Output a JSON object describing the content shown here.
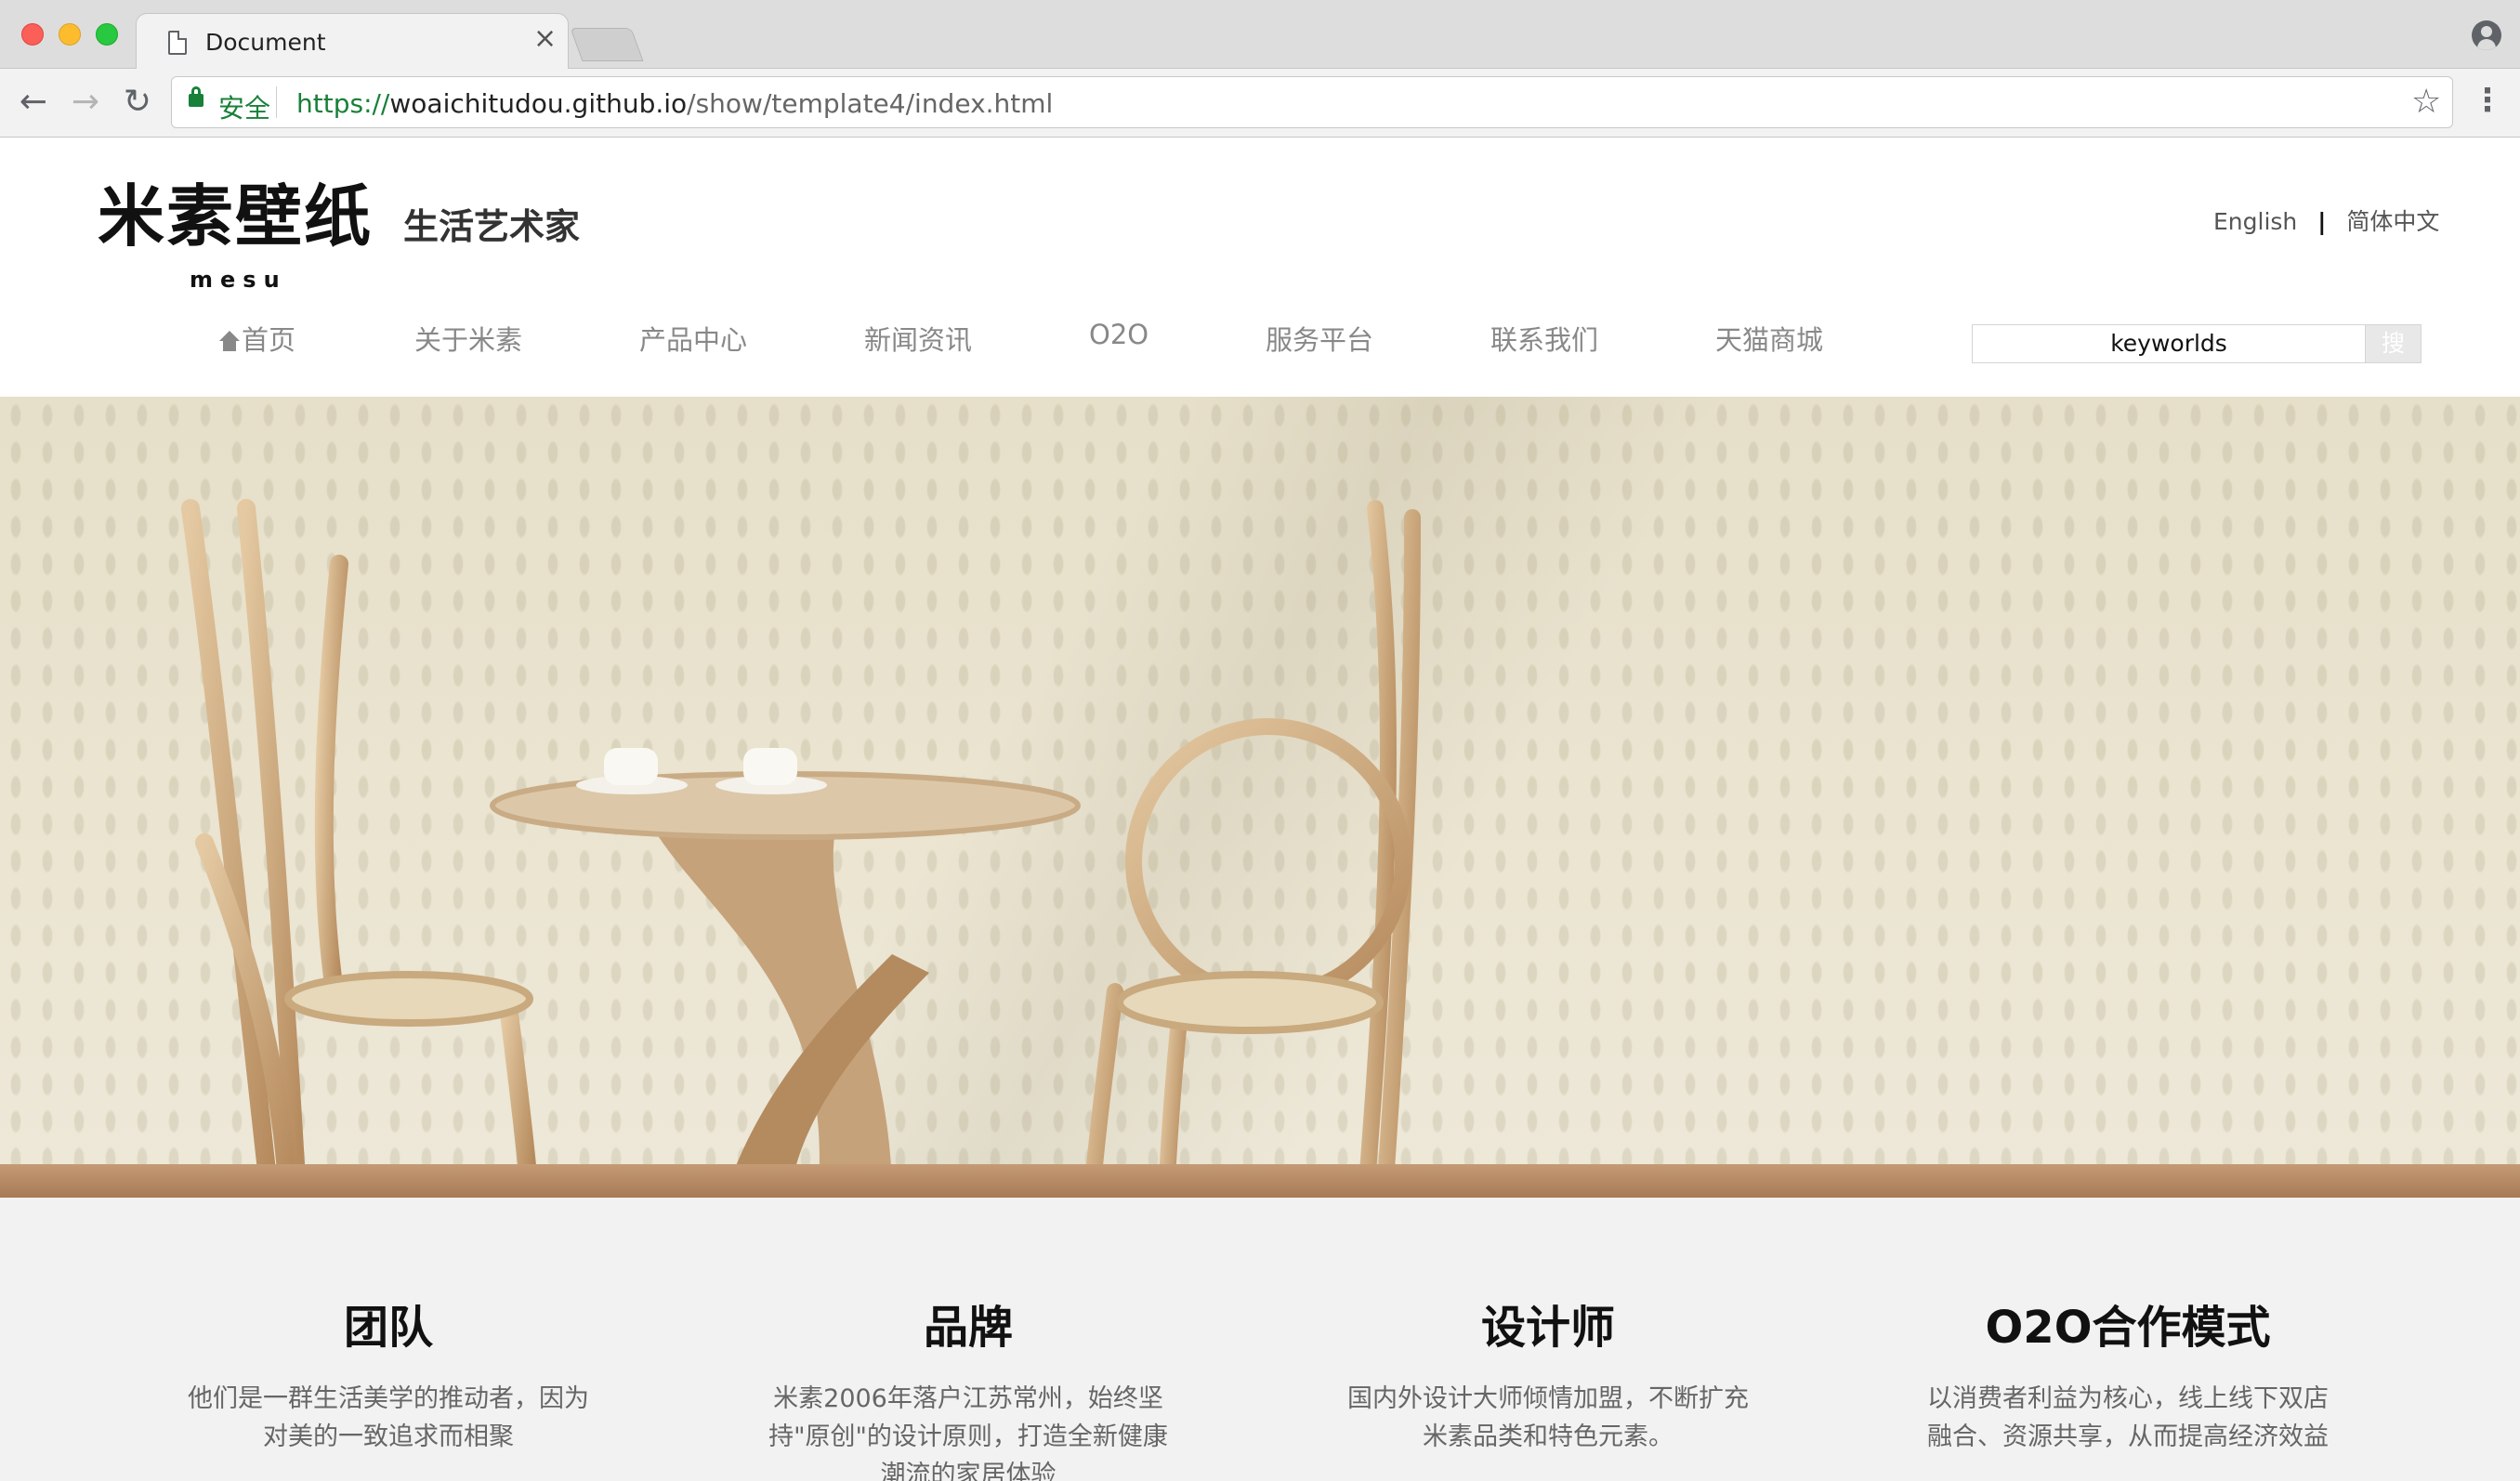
{
  "browser": {
    "tab_title": "Document",
    "tab_close": "×",
    "secure_label": "安全",
    "url_scheme": "https://",
    "url_host": "woaichitudou.github.io",
    "url_path": "/show/template4/index.html",
    "icons": [
      "back-icon",
      "forward-icon",
      "reload-icon",
      "lock-icon",
      "star-icon",
      "menu-icon",
      "profile-icon",
      "document-icon"
    ]
  },
  "header": {
    "logo_title": "米素壁纸",
    "logo_sub": "mesu",
    "slogan": "生活艺术家",
    "lang_english": "English",
    "lang_sep": "|",
    "lang_chinese": "简体中文"
  },
  "nav": {
    "items": [
      {
        "label": "首页"
      },
      {
        "label": "关于米素"
      },
      {
        "label": "产品中心"
      },
      {
        "label": "新闻资讯"
      },
      {
        "label": "O2O"
      },
      {
        "label": "服务平台"
      },
      {
        "label": "联系我们"
      },
      {
        "label": "天猫商城"
      }
    ],
    "search_value": "keyworlds",
    "search_button": "搜"
  },
  "features": [
    {
      "title": "团队",
      "text": "他们是一群生活美学的推动者，因为对美的一致追求而相聚"
    },
    {
      "title": "品牌",
      "text": "米素2006年落户江苏常州，始终坚持\"原创\"的设计原则，打造全新健康潮流的家居体验"
    },
    {
      "title": "设计师",
      "text": "国内外设计大师倾情加盟，不断扩充米素品类和特色元素。"
    },
    {
      "title": "O2O合作模式",
      "text": "以消费者利益为核心，线上线下双店融合、资源共享，从而提高经济效益"
    }
  ],
  "colors": {
    "secure_green": "#188038",
    "nav_gray": "#888888",
    "features_bg": "#f2f2f2",
    "hero_wall": "#e6dfc9"
  }
}
